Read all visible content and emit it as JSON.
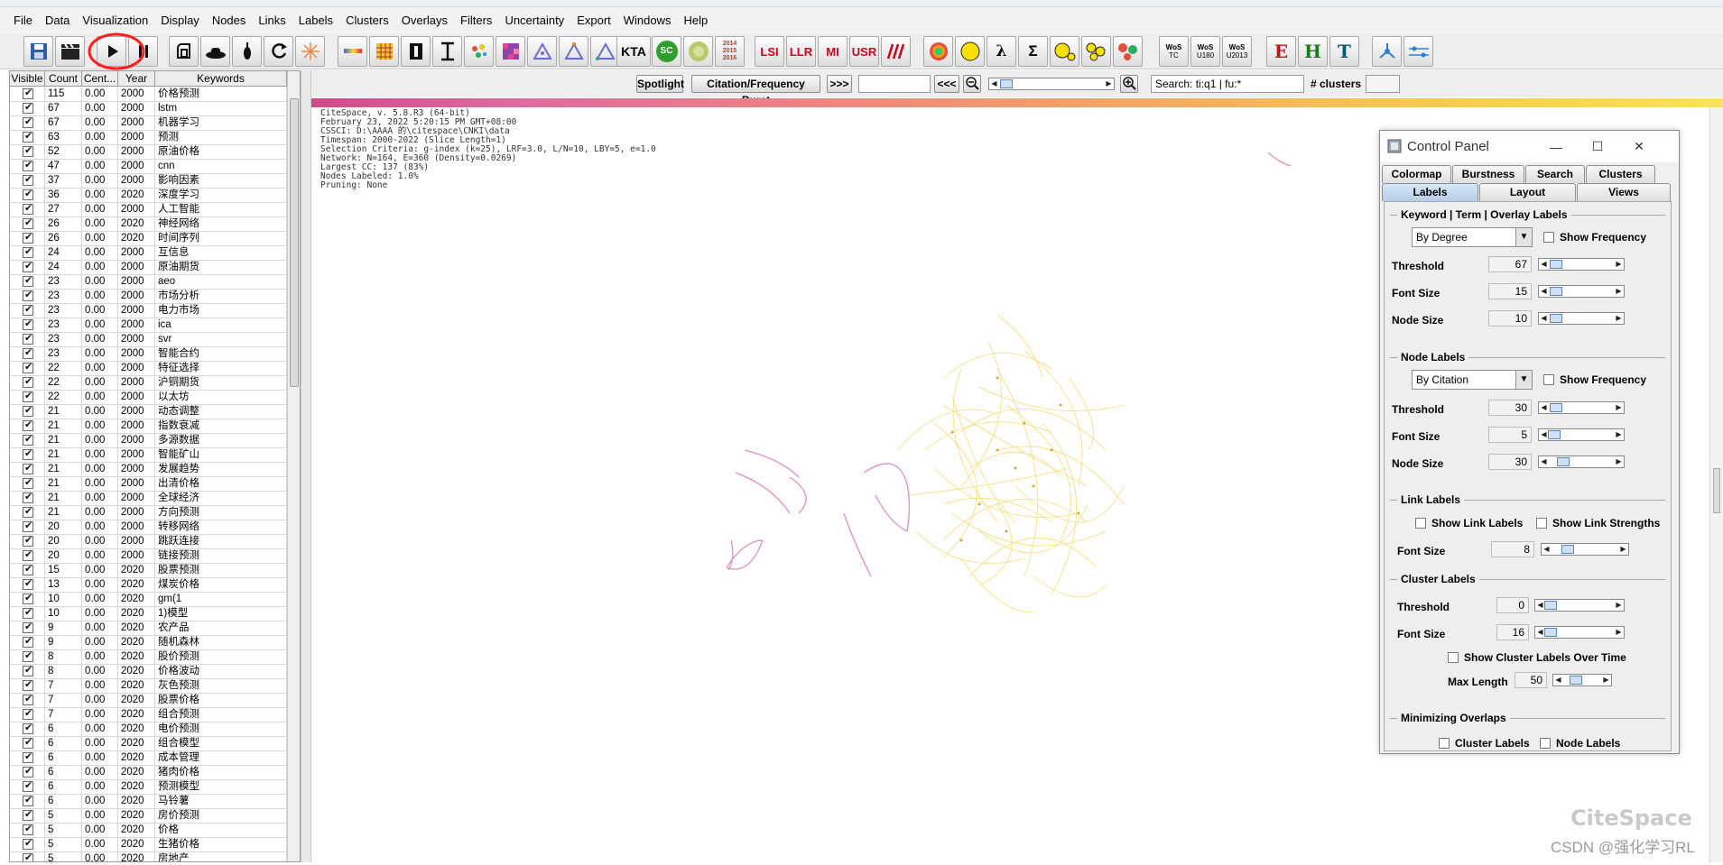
{
  "menu": [
    "File",
    "Data",
    "Visualization",
    "Display",
    "Nodes",
    "Links",
    "Labels",
    "Clusters",
    "Overlays",
    "Filters",
    "Uncertainty",
    "Export",
    "Windows",
    "Help"
  ],
  "toolbar": {
    "kta": "KTA",
    "sc": "SC",
    "years": [
      "2014",
      "2015",
      "2016"
    ],
    "lsi": "LSI",
    "llr": "LLR",
    "mi": "MI",
    "usr": "USR",
    "lambda": "λ",
    "sigma": "Σ",
    "wos_tc": [
      "WoS",
      "TC"
    ],
    "wos_u180": [
      "WoS",
      "U180"
    ],
    "wos_u2013": [
      "WoS",
      "U2013"
    ],
    "e": "E",
    "h": "H",
    "t": "T"
  },
  "table": {
    "headers": [
      "Visible",
      "Count",
      "Cent...",
      "Year",
      "Keywords"
    ],
    "rows": [
      [
        "115",
        "0.00",
        "2000",
        "价格预测"
      ],
      [
        "67",
        "0.00",
        "2000",
        "lstm"
      ],
      [
        "67",
        "0.00",
        "2000",
        "机器学习"
      ],
      [
        "63",
        "0.00",
        "2000",
        "预测"
      ],
      [
        "52",
        "0.00",
        "2000",
        "原油价格"
      ],
      [
        "47",
        "0.00",
        "2000",
        "cnn"
      ],
      [
        "37",
        "0.00",
        "2000",
        "影响因素"
      ],
      [
        "36",
        "0.00",
        "2020",
        "深度学习"
      ],
      [
        "27",
        "0.00",
        "2000",
        "人工智能"
      ],
      [
        "26",
        "0.00",
        "2020",
        "神经网络"
      ],
      [
        "26",
        "0.00",
        "2020",
        "时间序列"
      ],
      [
        "24",
        "0.00",
        "2000",
        "互信息"
      ],
      [
        "24",
        "0.00",
        "2000",
        "原油期货"
      ],
      [
        "23",
        "0.00",
        "2000",
        "aeo"
      ],
      [
        "23",
        "0.00",
        "2000",
        "市场分析"
      ],
      [
        "23",
        "0.00",
        "2000",
        "电力市场"
      ],
      [
        "23",
        "0.00",
        "2000",
        "ica"
      ],
      [
        "23",
        "0.00",
        "2000",
        "svr"
      ],
      [
        "23",
        "0.00",
        "2000",
        "智能合约"
      ],
      [
        "22",
        "0.00",
        "2000",
        "特征选择"
      ],
      [
        "22",
        "0.00",
        "2000",
        "沪铜期货"
      ],
      [
        "22",
        "0.00",
        "2000",
        "以太坊"
      ],
      [
        "21",
        "0.00",
        "2000",
        "动态调整"
      ],
      [
        "21",
        "0.00",
        "2000",
        "指数衰减"
      ],
      [
        "21",
        "0.00",
        "2000",
        "多源数据"
      ],
      [
        "21",
        "0.00",
        "2000",
        "智能矿山"
      ],
      [
        "21",
        "0.00",
        "2000",
        "发展趋势"
      ],
      [
        "21",
        "0.00",
        "2000",
        "出清价格"
      ],
      [
        "21",
        "0.00",
        "2000",
        "全球经济"
      ],
      [
        "21",
        "0.00",
        "2000",
        "方向预测"
      ],
      [
        "20",
        "0.00",
        "2000",
        "转移网络"
      ],
      [
        "20",
        "0.00",
        "2000",
        "跳跃连接"
      ],
      [
        "20",
        "0.00",
        "2000",
        "链接预测"
      ],
      [
        "15",
        "0.00",
        "2020",
        "股票预测"
      ],
      [
        "13",
        "0.00",
        "2020",
        "煤炭价格"
      ],
      [
        "10",
        "0.00",
        "2020",
        "gm(1"
      ],
      [
        "10",
        "0.00",
        "2020",
        "1)模型"
      ],
      [
        "9",
        "0.00",
        "2020",
        "农产品"
      ],
      [
        "9",
        "0.00",
        "2020",
        "随机森林"
      ],
      [
        "8",
        "0.00",
        "2020",
        "股价预测"
      ],
      [
        "8",
        "0.00",
        "2020",
        "价格波动"
      ],
      [
        "7",
        "0.00",
        "2020",
        "灰色预测"
      ],
      [
        "7",
        "0.00",
        "2020",
        "股票价格"
      ],
      [
        "7",
        "0.00",
        "2020",
        "组合预测"
      ],
      [
        "6",
        "0.00",
        "2020",
        "电价预测"
      ],
      [
        "6",
        "0.00",
        "2020",
        "组合模型"
      ],
      [
        "6",
        "0.00",
        "2020",
        "成本管理"
      ],
      [
        "6",
        "0.00",
        "2020",
        "猪肉价格"
      ],
      [
        "6",
        "0.00",
        "2020",
        "预测模型"
      ],
      [
        "6",
        "0.00",
        "2020",
        "马铃薯"
      ],
      [
        "5",
        "0.00",
        "2020",
        "房价预测"
      ],
      [
        "5",
        "0.00",
        "2020",
        "价格"
      ],
      [
        "5",
        "0.00",
        "2020",
        "生猪价格"
      ],
      [
        "5",
        "0.00",
        "2020",
        "房地产"
      ]
    ]
  },
  "controls": {
    "spotlight": "Spotlight",
    "burst": "Citation/Frequency Burst",
    "next": ">>>",
    "prev": "<<<",
    "search_value": "Search: ti:q1 | fu:*",
    "clusters_label": "# clusters"
  },
  "info_lines": [
    "CiteSpace, v. 5.8.R3 (64-bit)",
    "February 23, 2022 5:20:15 PM GMT+08:00",
    "CSSCI: D:\\AAAA         的\\citespace\\CNKI\\data",
    "Timespan: 2000-2022 (Slice Length=1)",
    "Selection Criteria: g-index (k=25), LRF=3.0, L/N=10, LBY=5, e=1.0",
    "Network: N=164, E=360 (Density=0.0269)",
    "Largest CC: 137 (83%)",
    "Nodes Labeled: 1.0%",
    "Pruning: None"
  ],
  "control_panel": {
    "title": "Control Panel",
    "tabs_top": [
      "Colormap",
      "Burstness",
      "Search",
      "Clusters"
    ],
    "tabs_bottom": [
      "Labels",
      "Layout",
      "Views"
    ],
    "kw_section": "Keyword | Term | Overlay Labels",
    "kw_combo": "By Degree",
    "show_frequency": "Show Frequency",
    "threshold_label": "Threshold",
    "font_size_label": "Font Size",
    "node_size_label": "Node Size",
    "kw_threshold": "67",
    "kw_font": "15",
    "kw_node": "10",
    "node_section": "Node Labels",
    "node_combo": "By Citation",
    "node_threshold": "30",
    "node_font": "5",
    "node_node": "30",
    "link_section": "Link Labels",
    "show_link_labels": "Show Link Labels",
    "show_link_strengths": "Show Link Strengths",
    "link_font": "8",
    "cluster_section": "Cluster Labels",
    "cluster_threshold": "0",
    "cluster_font": "16",
    "show_over_time": "Show Cluster Labels Over Time",
    "max_length_label": "Max Length",
    "max_length": "50",
    "min_section": "Minimizing Overlaps",
    "cluster_labels": "Cluster Labels",
    "node_labels": "Node Labels"
  },
  "watermark": {
    "brand": "CiteSpace",
    "csdn": "CSDN @强化学习RL"
  },
  "colors": {
    "accent": "#5a83c2",
    "annotation": "#ff1e1e",
    "node_yellow": "#f4d24a",
    "node_pink": "#d873b8"
  }
}
